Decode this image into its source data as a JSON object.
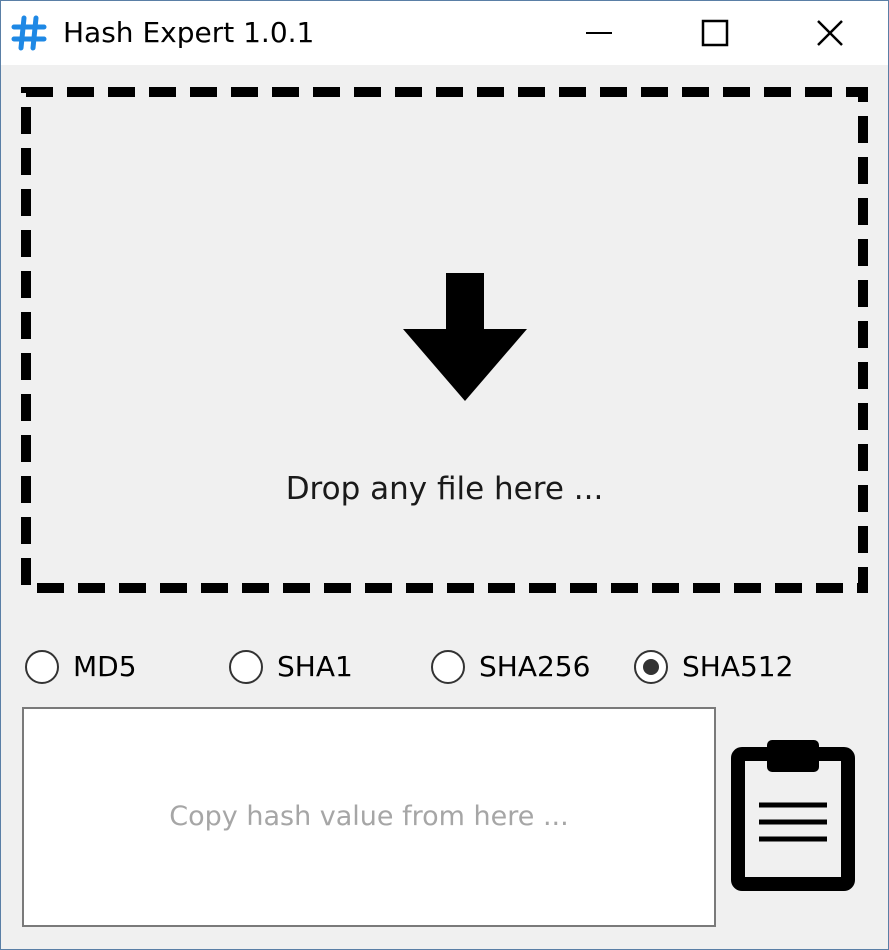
{
  "window": {
    "title": "Hash Expert 1.0.1",
    "icon": "hash-icon",
    "controls": [
      "minimize-icon",
      "maximize-icon",
      "close-icon"
    ],
    "accent_color": "#1e88e5"
  },
  "drop_zone": {
    "icon": "down-arrow-icon",
    "text": "Drop any file here ..."
  },
  "algorithms": {
    "options": [
      {
        "label": "MD5",
        "selected": false
      },
      {
        "label": "SHA1",
        "selected": false
      },
      {
        "label": "SHA256",
        "selected": false
      },
      {
        "label": "SHA512",
        "selected": true
      }
    ]
  },
  "output": {
    "value": "",
    "placeholder": "Copy hash value from here ..."
  },
  "copy_button": {
    "icon": "clipboard-icon"
  }
}
